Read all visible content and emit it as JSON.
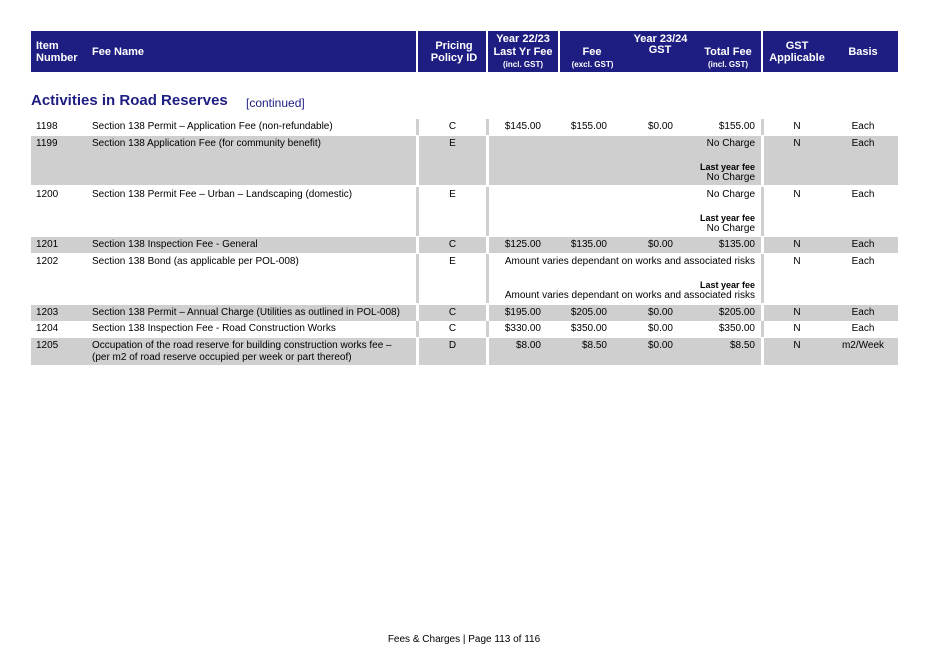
{
  "header": {
    "item_number": "Item Number",
    "fee_name": "Fee Name",
    "pricing_policy": "Pricing Policy ID",
    "year2223": "Year 22/23",
    "last_yr_fee": "Last Yr Fee",
    "incl_gst_1": "(incl. GST)",
    "year2324": "Year 23/24",
    "fee": "Fee",
    "excl_gst": "(excl. GST)",
    "gst": "GST",
    "total_fee": "Total Fee",
    "incl_gst_2": "(incl. GST)",
    "gst_applicable": "GST Applicable",
    "basis": "Basis"
  },
  "section": {
    "title": "Activities in Road Reserves",
    "continued": "[continued]"
  },
  "rows": [
    {
      "item": "1198",
      "name": "Section 138 Permit – Application Fee (non-refundable)",
      "policy": "C",
      "last": "$145.00",
      "fee": "$155.00",
      "gst": "$0.00",
      "total": "$155.00",
      "gst_app": "N",
      "basis": "Each"
    },
    {
      "item": "1199",
      "name": "Section 138 Application Fee (for community benefit)",
      "policy": "E",
      "total": "No Charge",
      "last_label": "Last year fee",
      "last_value": "No Charge",
      "gst_app": "N",
      "basis": "Each"
    },
    {
      "item": "1200",
      "name": "Section 138 Permit Fee – Urban – Landscaping (domestic)",
      "policy": "E",
      "total": "No Charge",
      "last_label": "Last year fee",
      "last_value": "No Charge",
      "gst_app": "N",
      "basis": "Each"
    },
    {
      "item": "1201",
      "name": "Section 138 Inspection Fee - General",
      "policy": "C",
      "last": "$125.00",
      "fee": "$135.00",
      "gst": "$0.00",
      "total": "$135.00",
      "gst_app": "N",
      "basis": "Each"
    },
    {
      "item": "1202",
      "name": "Section 138 Bond (as applicable per POL-008)",
      "policy": "E",
      "total": "Amount varies dependant on works and associated risks",
      "last_label": "Last year fee",
      "last_value": "Amount varies dependant on works and associated risks",
      "gst_app": "N",
      "basis": "Each"
    },
    {
      "item": "1203",
      "name": "Section 138 Permit – Annual Charge (Utilities as outlined in POL-008)",
      "policy": "C",
      "last": "$195.00",
      "fee": "$205.00",
      "gst": "$0.00",
      "total": "$205.00",
      "gst_app": "N",
      "basis": "Each"
    },
    {
      "item": "1204",
      "name": "Section 138 Inspection Fee - Road Construction Works",
      "policy": "C",
      "last": "$330.00",
      "fee": "$350.00",
      "gst": "$0.00",
      "total": "$350.00",
      "gst_app": "N",
      "basis": "Each"
    },
    {
      "item": "1205",
      "name": "Occupation of the road reserve for building construction works fee – (per m2 of road reserve occupied per week or part thereof)",
      "policy": "D",
      "last": "$8.00",
      "fee": "$8.50",
      "gst": "$0.00",
      "total": "$8.50",
      "gst_app": "N",
      "basis": "m2/Week"
    }
  ],
  "footer": "Fees & Charges | Page 113 of 116"
}
